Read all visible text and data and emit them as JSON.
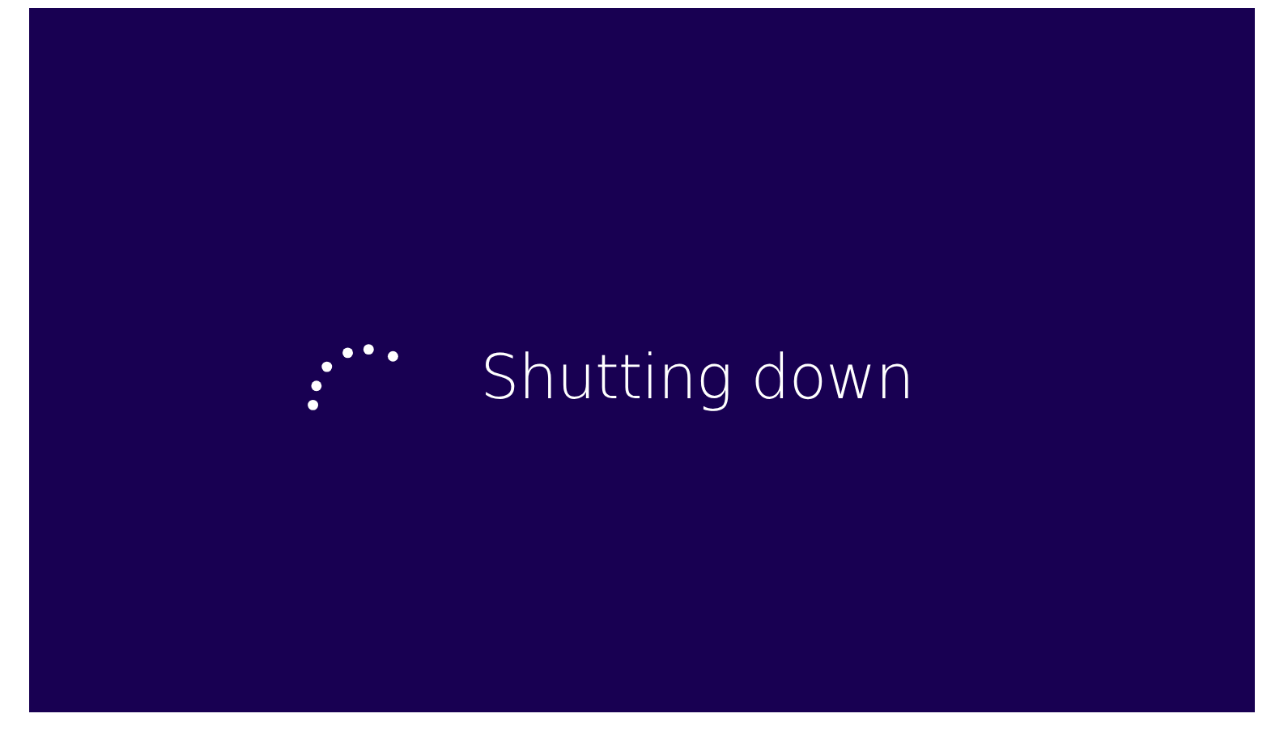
{
  "message": "Shutting down"
}
